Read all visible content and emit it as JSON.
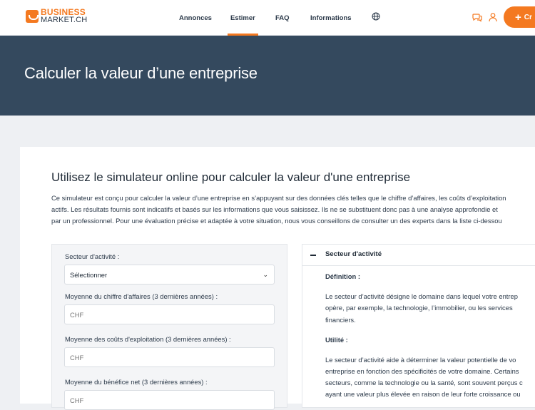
{
  "header": {
    "logo_top": "BUSINESS",
    "logo_bottom": "MARKET.CH",
    "nav": [
      {
        "label": "Annonces"
      },
      {
        "label": "Estimer"
      },
      {
        "label": "FAQ"
      },
      {
        "label": "Informations"
      }
    ],
    "active_nav": "Estimer",
    "icons": [
      "globe-icon",
      "chat-icon",
      "user-icon"
    ],
    "cta_label": "Cr",
    "cta_icon": "plus-icon"
  },
  "hero": {
    "title": "Calculer la valeur d’une entreprise"
  },
  "main": {
    "title": "Utilisez le simulateur online pour calculer la valeur d'une entreprise",
    "intro_lines": [
      "Ce simulateur est conçu pour calculer la valeur d’une entreprise en s’appuyant sur des données clés telles que le chiffre d’affaires, les coûts d’exploitation",
      "actifs. Les résultats fournis sont indicatifs et basés sur les informations que vous saisissez. Ils ne se substituent donc pas à une analyse approfondie et",
      "par un professionnel. Pour une évaluation précise et adaptée à votre situation, nous vous conseillons de consulter un des experts dans la liste ci-dessou"
    ]
  },
  "form": {
    "sector_label": "Secteur d'activité :",
    "sector_value": "Sélectionner",
    "revenue_label": "Moyenne du chiffre d'affaires (3 dernières années) :",
    "revenue_placeholder": "CHF",
    "costs_label": "Moyenne des coûts d'exploitation (3 dernières années) :",
    "costs_placeholder": "CHF",
    "profit_label": "Moyenne du bénéfice net (3 dernières années) :",
    "profit_placeholder": "CHF"
  },
  "accordion": {
    "title": "Secteur d'activité",
    "definition_heading": "Définition :",
    "definition_lines": [
      "Le secteur d’activité désigne le domaine dans lequel votre entrep",
      "opère, par exemple, la technologie, l’immobilier, ou les services",
      "financiers."
    ],
    "utility_heading": "Utilité :",
    "utility_lines": [
      "Le secteur d’activité aide à déterminer la valeur potentielle de vo",
      "entreprise en fonction des spécificités de votre domaine. Certains",
      "secteurs, comme la technologie ou la santé, sont souvent perçus c",
      "ayant une valeur plus élevée en raison de leur forte croissance ou"
    ]
  },
  "colors": {
    "accent": "#f47920",
    "hero_bg": "#34495e",
    "page_bg": "#eef0f3"
  }
}
